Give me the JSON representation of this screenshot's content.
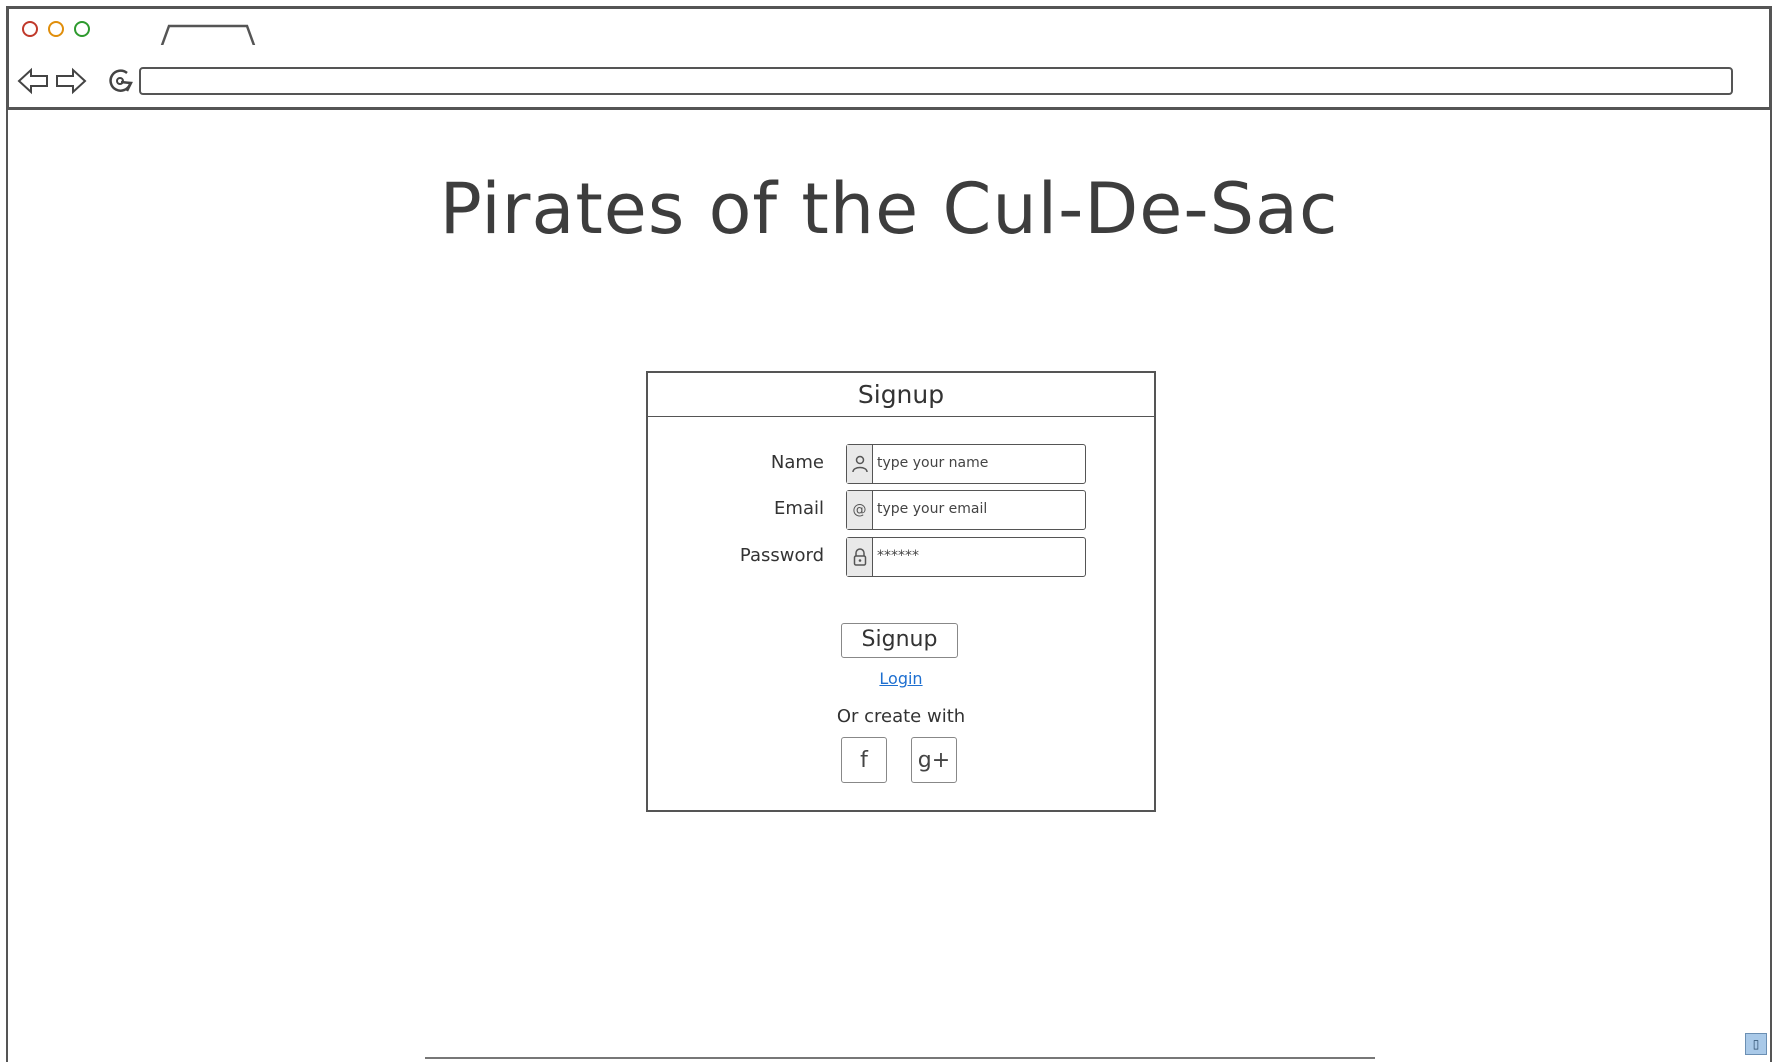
{
  "browser": {
    "url": "",
    "back_icon": "arrow-left-icon",
    "forward_icon": "arrow-right-icon",
    "reload_icon": "reload-icon"
  },
  "page": {
    "title": "Pirates of the Cul-De-Sac"
  },
  "signup_panel": {
    "header": "Signup",
    "fields": [
      {
        "label": "Name",
        "icon": "user-icon",
        "value": "type your name"
      },
      {
        "label": "Email",
        "icon": "at-icon",
        "value": "type your email"
      },
      {
        "label": "Password",
        "icon": "lock-icon",
        "value": "******"
      }
    ],
    "submit_label": "Signup",
    "login_link": "Login",
    "or_text": "Or create with",
    "social": [
      {
        "icon": "facebook-icon",
        "glyph": "f"
      },
      {
        "icon": "google-plus-icon",
        "glyph": "g+"
      }
    ]
  },
  "colors": {
    "link": "#1e6fd0",
    "traffic_red": "#c0392b",
    "traffic_yellow": "#e08e0b",
    "traffic_green": "#2e9a2e"
  }
}
